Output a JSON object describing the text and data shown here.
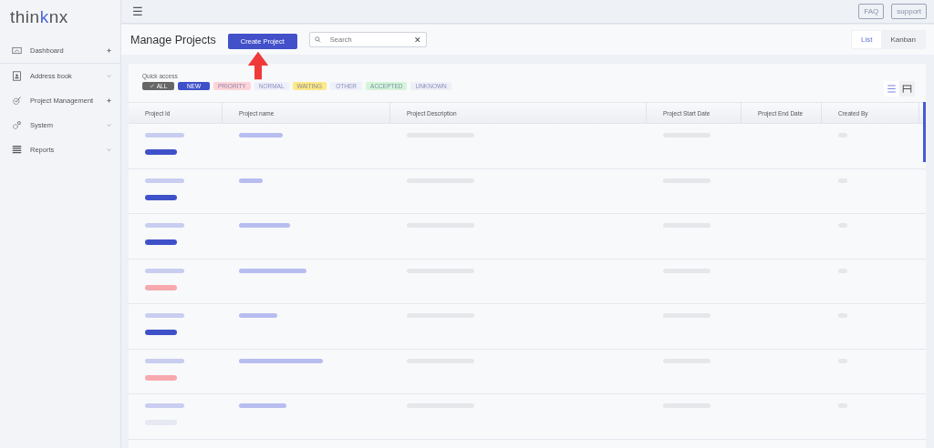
{
  "logo": {
    "text": "thinknx"
  },
  "sidebar": {
    "items": [
      {
        "label": "Dashboard",
        "expandable": false
      },
      {
        "label": "Address book",
        "expandable": true
      },
      {
        "label": "Project Management",
        "expandable": false
      },
      {
        "label": "System",
        "expandable": true
      },
      {
        "label": "Reports",
        "expandable": true
      }
    ]
  },
  "topbar": {
    "menu_glyph": "☰",
    "buttons": [
      "FAQ",
      "support"
    ]
  },
  "header": {
    "title": "Manage Projects",
    "create_button": "Create Project",
    "search": {
      "placeholder": "Search",
      "clear_glyph": "✕"
    },
    "view_tabs": [
      {
        "label": "List",
        "selected": true
      },
      {
        "label": "Kanban",
        "selected": false
      }
    ]
  },
  "quick_access": {
    "label": "Quick access",
    "chips": [
      {
        "label": "ALL",
        "selected": true,
        "kind": "solid",
        "color": "#666666"
      },
      {
        "label": "NEW",
        "selected": false,
        "kind": "solid",
        "color": "#3f51c8"
      },
      {
        "label": "PRIORITY",
        "selected": false,
        "kind": "soft",
        "color": "#fdd5d8"
      },
      {
        "label": "NORMAL",
        "selected": false,
        "kind": "soft",
        "color": "#eef0fa"
      },
      {
        "label": "WAITING",
        "selected": false,
        "kind": "soft",
        "color": "#fbe98a"
      },
      {
        "label": "OTHER",
        "selected": false,
        "kind": "soft",
        "color": "#eef0fa"
      },
      {
        "label": "ACCEPTED",
        "selected": false,
        "kind": "soft",
        "color": "#d3f5d8"
      },
      {
        "label": "UNKNOWN",
        "selected": false,
        "kind": "soft",
        "color": "#eef0f7"
      }
    ]
  },
  "layout_toggle": [
    {
      "selected": true
    },
    {
      "selected": false
    }
  ],
  "table": {
    "columns": [
      "Project Id",
      "Project name",
      "Project Description",
      "Project Start Date",
      "Project End Date",
      "Created By"
    ],
    "rows": [
      {
        "color": "#3f51c8"
      },
      {
        "color": "#3f51c8"
      },
      {
        "color": "#3f51c8"
      },
      {
        "color": "#f7a9ae"
      },
      {
        "color": "#3f51c8"
      },
      {
        "color": "#f7a9ae"
      },
      {
        "color": "#e6e8f2"
      }
    ]
  }
}
